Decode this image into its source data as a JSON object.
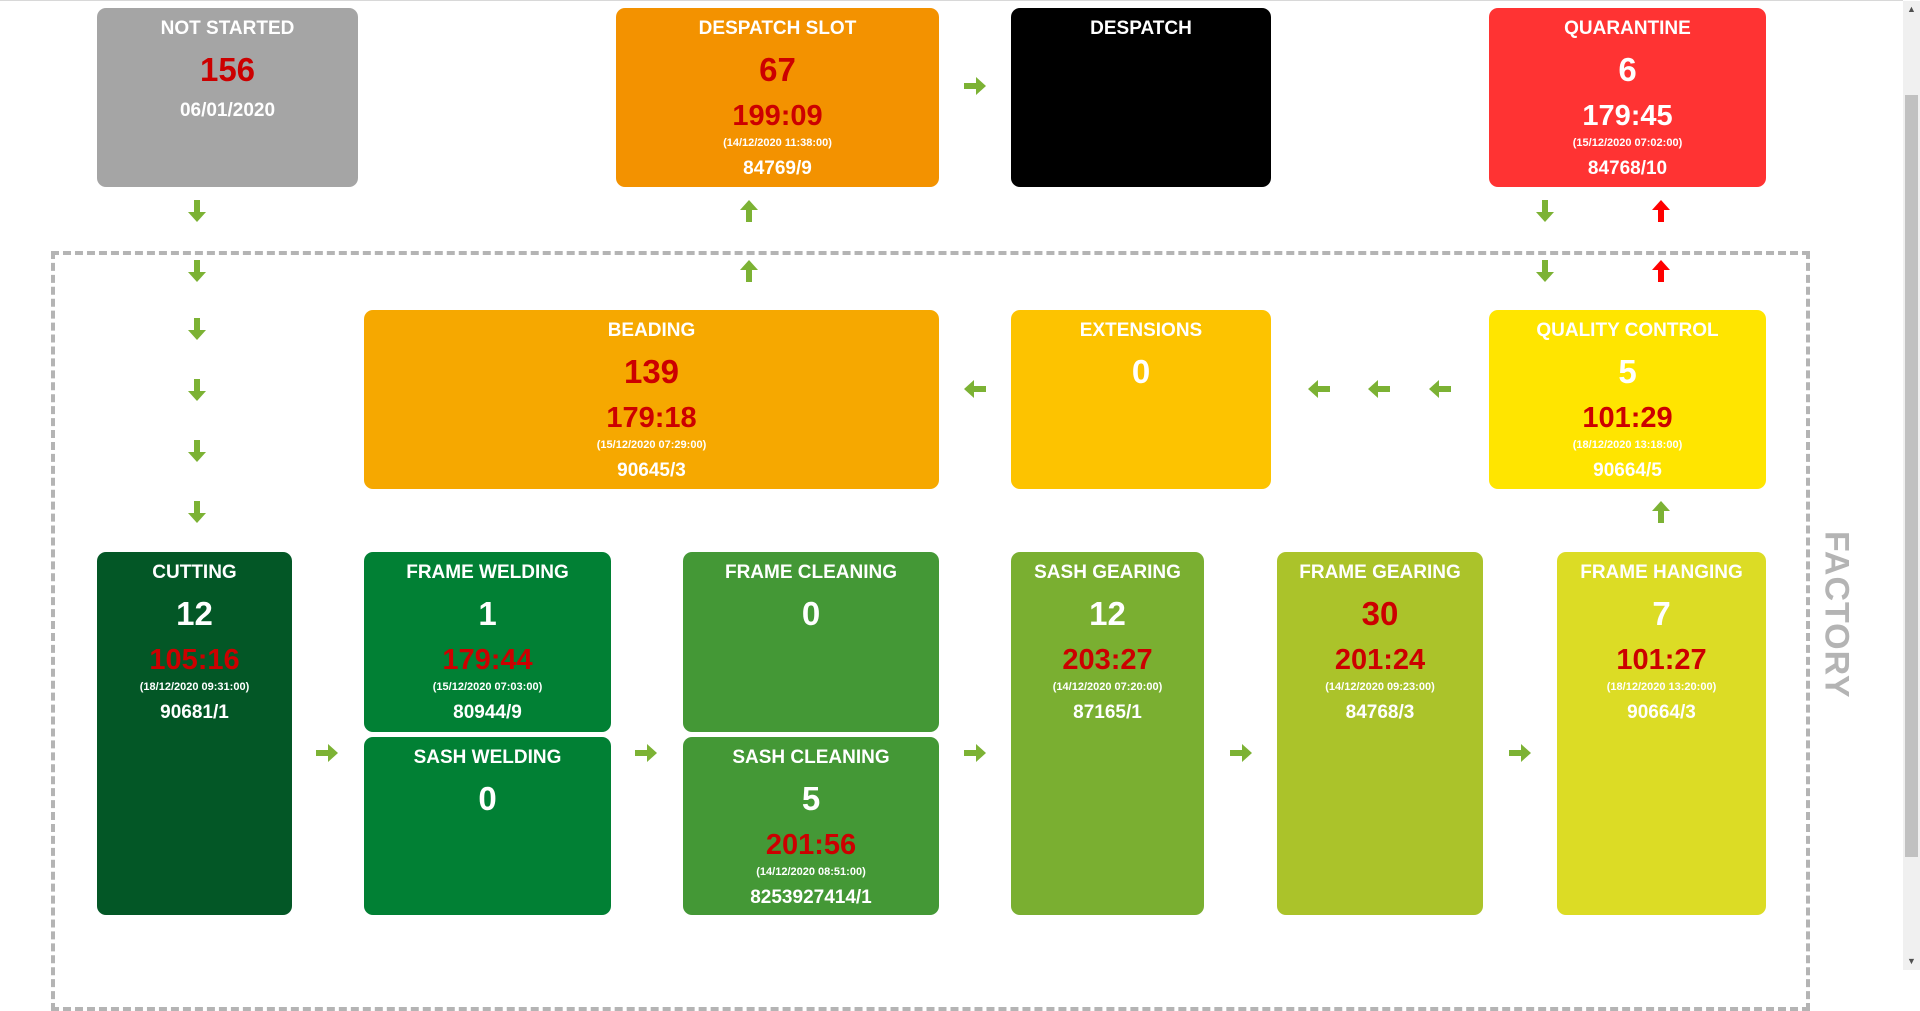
{
  "colors": {
    "arrow_green": "#7cb234",
    "arrow_red": "#ff0000",
    "alert_text": "#cc0000",
    "frame_border": "#b4b4b4"
  },
  "factory_label": "FACTORY",
  "stations": {
    "not_started": {
      "title": "NOT STARTED",
      "count": "156",
      "count_alert": true,
      "date_label": "06/01/2020",
      "bg": "#a5a5a5"
    },
    "despatch_slot": {
      "title": "DESPATCH SLOT",
      "count": "67",
      "count_alert": true,
      "time": "199:09",
      "time_alert": true,
      "datetime": "(14/12/2020 11:38:00)",
      "order": "84769/9",
      "bg": "#f39200"
    },
    "despatch": {
      "title": "DESPATCH",
      "bg": "#000000"
    },
    "quarantine": {
      "title": "QUARANTINE",
      "count": "6",
      "count_alert": false,
      "time": "179:45",
      "time_alert": false,
      "datetime": "(15/12/2020 07:02:00)",
      "order": "84768/10",
      "bg": "#ff3333"
    },
    "beading": {
      "title": "BEADING",
      "count": "139",
      "count_alert": true,
      "time": "179:18",
      "time_alert": true,
      "datetime": "(15/12/2020 07:29:00)",
      "order": "90645/3",
      "bg": "#f6a800"
    },
    "extensions": {
      "title": "EXTENSIONS",
      "count": "0",
      "count_alert": false,
      "bg": "#fdc300"
    },
    "quality_control": {
      "title": "QUALITY CONTROL",
      "count": "5",
      "count_alert": false,
      "time": "101:29",
      "time_alert": true,
      "datetime": "(18/12/2020 13:18:00)",
      "order": "90664/5",
      "bg": "#ffe500"
    },
    "cutting": {
      "title": "CUTTING",
      "count": "12",
      "count_alert": false,
      "time": "105:16",
      "time_alert": true,
      "datetime": "(18/12/2020 09:31:00)",
      "order": "90681/1",
      "bg": "#035726"
    },
    "frame_welding": {
      "title": "FRAME WELDING",
      "count": "1",
      "count_alert": false,
      "time": "179:44",
      "time_alert": true,
      "datetime": "(15/12/2020 07:03:00)",
      "order": "80944/9",
      "bg": "#018034"
    },
    "sash_welding": {
      "title": "SASH WELDING",
      "count": "0",
      "count_alert": false,
      "bg": "#018034"
    },
    "frame_cleaning": {
      "title": "FRAME CLEANING",
      "count": "0",
      "count_alert": false,
      "bg": "#449836"
    },
    "sash_cleaning": {
      "title": "SASH CLEANING",
      "count": "5",
      "count_alert": false,
      "time": "201:56",
      "time_alert": true,
      "datetime": "(14/12/2020 08:51:00)",
      "order": "8253927414/1",
      "bg": "#449836"
    },
    "sash_gearing": {
      "title": "SASH GEARING",
      "count": "12",
      "count_alert": false,
      "time": "203:27",
      "time_alert": true,
      "datetime": "(14/12/2020 07:20:00)",
      "order": "87165/1",
      "bg": "#7aaf31"
    },
    "frame_gearing": {
      "title": "FRAME GEARING",
      "count": "30",
      "count_alert": true,
      "time": "201:24",
      "time_alert": true,
      "datetime": "(14/12/2020 09:23:00)",
      "order": "84768/3",
      "bg": "#abc32a"
    },
    "frame_hanging": {
      "title": "FRAME HANGING",
      "count": "7",
      "count_alert": false,
      "time": "101:27",
      "time_alert": true,
      "datetime": "(18/12/2020 13:20:00)",
      "order": "90664/3",
      "bg": "#dcdc25"
    }
  },
  "icons": {
    "flow_arrow": "arrow-icon",
    "return_arrow": "arrow-up-red-icon",
    "scroll_up": "▲",
    "scroll_down": "▼"
  }
}
